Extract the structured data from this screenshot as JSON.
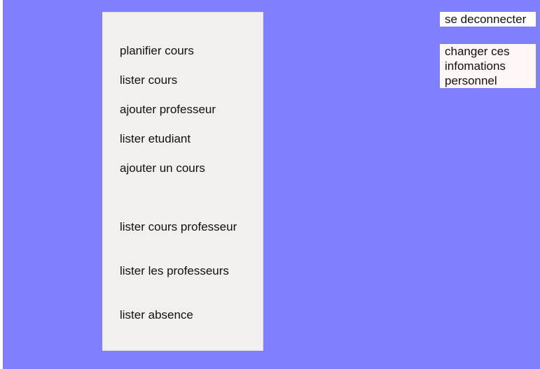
{
  "colors": {
    "background": "#8080ff",
    "menu_panel": "#f3efee",
    "button": "#ffffff"
  },
  "menu": {
    "items": [
      {
        "label": "planifier cours"
      },
      {
        "label": "lister cours"
      },
      {
        "label": "ajouter professeur"
      },
      {
        "label": "lister etudiant"
      },
      {
        "label": "ajouter un cours"
      },
      {
        "label": "lister cours professeur"
      },
      {
        "label": "lister les professeurs"
      },
      {
        "label": "lister absence"
      }
    ]
  },
  "header": {
    "logout_label": "se deconnecter",
    "profile_label": "changer ces infomations personnel"
  }
}
